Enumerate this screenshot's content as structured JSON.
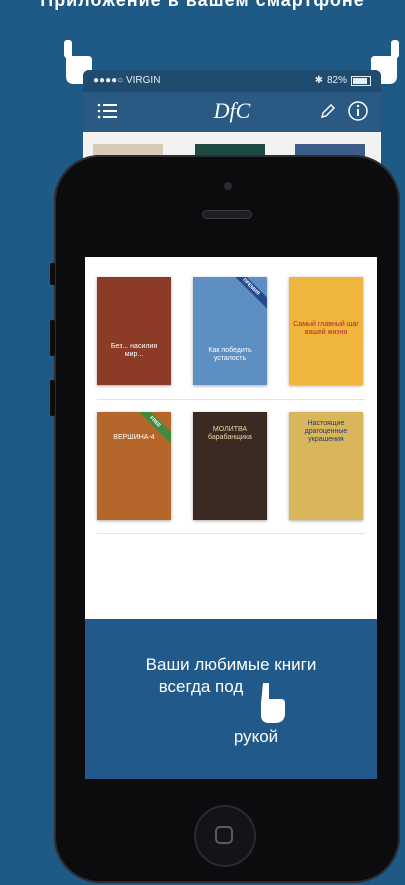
{
  "header": {
    "partial_text": "Приложение в вашем смартфоне"
  },
  "status_bar": {
    "carrier": "●●●●○ VIRGIN",
    "battery": "82%"
  },
  "nav": {
    "logo": "DfC"
  },
  "books": [
    {
      "title": "Без... насилия мир...",
      "bg": "#8c3b26",
      "ribbon": ""
    },
    {
      "title": "Как победить усталость",
      "bg": "#5d8fc3",
      "ribbon": "ПРЕМИЯ"
    },
    {
      "title": "Самый главный шаг вашей жизни",
      "bg": "#f0b53c",
      "ribbon": ""
    },
    {
      "title": "ВЕРШИНА-4",
      "bg": "#b4662b",
      "ribbon": "FREE"
    },
    {
      "title": "МОЛИТВА барабанщика",
      "bg": "#3b2a22",
      "ribbon": ""
    },
    {
      "title": "Настоящие драгоценные украшения",
      "bg": "#d9b65a",
      "ribbon": ""
    }
  ],
  "promo": {
    "line1": "Ваши любимые книги",
    "line2": "всегда под",
    "line3": "рукой"
  },
  "colors": {
    "background": "#1f5a86",
    "navbar": "#2a5a83",
    "promo": "#20598a",
    "phone": "#0c0b0e"
  }
}
